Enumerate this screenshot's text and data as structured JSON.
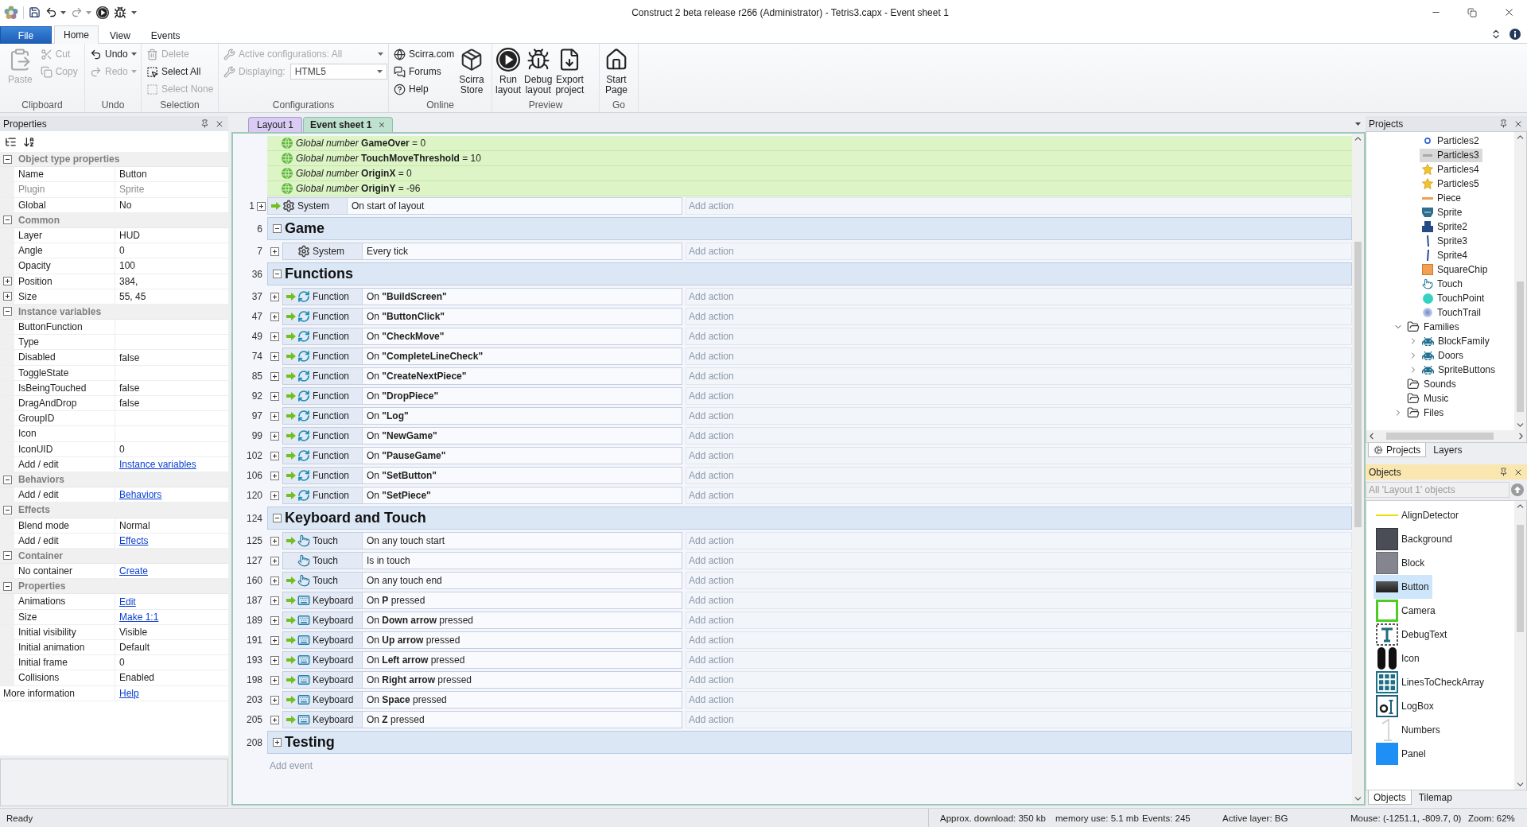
{
  "window": {
    "title": "Construct 2 beta release r266 (Administrator) - Tetris3.capx - Event sheet 1"
  },
  "ribbon": {
    "tabs": [
      {
        "label": "File",
        "kind": "file",
        "selected": false
      },
      {
        "label": "Home",
        "kind": "page",
        "selected": true
      },
      {
        "label": "View",
        "kind": "page",
        "selected": false
      },
      {
        "label": "Events",
        "kind": "page",
        "selected": false
      }
    ],
    "groups": [
      {
        "label": "Clipboard",
        "items": [
          {
            "kind": "large",
            "label": "Paste",
            "disabled": true
          },
          {
            "kind": "small",
            "label": "Cut",
            "disabled": true
          },
          {
            "kind": "small",
            "label": "Copy",
            "disabled": true
          }
        ]
      },
      {
        "label": "Undo",
        "items": [
          {
            "kind": "split",
            "label": "Undo",
            "disabled": false
          },
          {
            "kind": "split",
            "label": "Redo",
            "disabled": true
          }
        ]
      },
      {
        "label": "Selection",
        "items": [
          {
            "kind": "small",
            "label": "Delete",
            "disabled": true
          },
          {
            "kind": "small",
            "label": "Select All",
            "disabled": false
          },
          {
            "kind": "small",
            "label": "Select None",
            "disabled": true
          }
        ]
      },
      {
        "label": "Configurations",
        "items": [
          {
            "kind": "dropdown",
            "label": "Active configurations: All",
            "disabled": true
          },
          {
            "kind": "field",
            "label": "Displaying:",
            "value": "HTML5",
            "disabled": true
          }
        ]
      },
      {
        "label": "Online",
        "items": [
          {
            "kind": "small",
            "label": "Scirra.com",
            "disabled": false
          },
          {
            "kind": "small",
            "label": "Forums",
            "disabled": false
          },
          {
            "kind": "small",
            "label": "Help",
            "disabled": false
          },
          {
            "kind": "large",
            "label": "Scirra Store",
            "disabled": false
          }
        ]
      },
      {
        "label": "Preview",
        "items": [
          {
            "kind": "large",
            "label": "Run layout",
            "disabled": false
          },
          {
            "kind": "large",
            "label": "Debug layout",
            "disabled": false
          },
          {
            "kind": "large",
            "label": "Export project",
            "disabled": false
          }
        ]
      },
      {
        "label": "Go",
        "items": [
          {
            "kind": "large",
            "label": "Start Page",
            "disabled": false
          }
        ]
      }
    ]
  },
  "properties": {
    "title": "Properties",
    "active": false,
    "sections": [
      {
        "title": "Object type properties",
        "expanded": true,
        "rows": [
          {
            "name": "Name",
            "value": "Button",
            "kind": "text"
          },
          {
            "name": "Plugin",
            "value": "Sprite",
            "kind": "readonly"
          },
          {
            "name": "Global",
            "value": "No",
            "kind": "text"
          }
        ]
      },
      {
        "title": "Common",
        "expanded": true,
        "rows": [
          {
            "name": "Layer",
            "value": "HUD",
            "kind": "text"
          },
          {
            "name": "Angle",
            "value": "0",
            "kind": "text"
          },
          {
            "name": "Opacity",
            "value": "100",
            "kind": "text"
          },
          {
            "name": "Position",
            "value": "384,",
            "kind": "text",
            "expanded": false
          },
          {
            "name": "Size",
            "value": "55, 45",
            "kind": "text",
            "expanded": false
          }
        ]
      },
      {
        "title": "Instance variables",
        "expanded": true,
        "rows": [
          {
            "name": "ButtonFunction",
            "kind": "text"
          },
          {
            "name": "Type",
            "kind": "text"
          },
          {
            "name": "Disabled",
            "value": "false",
            "kind": "text"
          },
          {
            "name": "ToggleState",
            "kind": "text"
          },
          {
            "name": "IsBeingTouched",
            "value": "false",
            "kind": "text"
          },
          {
            "name": "DragAndDrop",
            "value": "false",
            "kind": "text"
          },
          {
            "name": "GroupID",
            "kind": "text"
          },
          {
            "name": "Icon",
            "kind": "text"
          },
          {
            "name": "IconUID",
            "value": "0",
            "kind": "text"
          },
          {
            "name": "Add / edit",
            "value": "Instance variables",
            "kind": "link"
          }
        ]
      },
      {
        "title": "Behaviors",
        "expanded": true,
        "rows": [
          {
            "name": "Add / edit",
            "value": "Behaviors",
            "kind": "link"
          }
        ]
      },
      {
        "title": "Effects",
        "expanded": true,
        "rows": [
          {
            "name": "Blend mode",
            "value": "Normal",
            "kind": "text"
          },
          {
            "name": "Add / edit",
            "value": "Effects",
            "kind": "link"
          }
        ]
      },
      {
        "title": "Container",
        "expanded": true,
        "rows": [
          {
            "name": "No container",
            "value": "Create",
            "kind": "link"
          }
        ]
      },
      {
        "title": "Properties",
        "expanded": true,
        "rows": [
          {
            "name": "Animations",
            "value": "Edit",
            "kind": "link"
          },
          {
            "name": "Size",
            "value": "Make 1:1",
            "kind": "link"
          },
          {
            "name": "Initial visibility",
            "value": "Visible",
            "kind": "text"
          },
          {
            "name": "Initial animation",
            "value": "Default",
            "kind": "text"
          },
          {
            "name": "Initial frame",
            "value": "0",
            "kind": "text"
          },
          {
            "name": "Collisions",
            "value": "Enabled",
            "kind": "text"
          }
        ]
      }
    ],
    "footer": {
      "name": "More information",
      "value": "Help",
      "kind": "link"
    }
  },
  "event_sheet": {
    "tabs": [
      {
        "label": "Layout 1",
        "kind": "layout",
        "selected": false
      },
      {
        "label": "Event sheet 1",
        "kind": "events",
        "selected": true
      }
    ],
    "globals": [
      "*Global number* **GameOver** = 0",
      "*Global number* **TouchMoveThreshold** = 10",
      "*Global number* **OriginX** = 0",
      "*Global number* **OriginY** = -96"
    ],
    "events": [
      {
        "kind": "system",
        "line": "1",
        "object": "System",
        "condition": "On start of layout",
        "action": "Add action",
        "trigger": true,
        "expanded": false
      },
      {
        "kind": "group",
        "line": "6",
        "title": "Game",
        "expanded": true,
        "children": [
          {
            "kind": "system",
            "line": "7",
            "object": "System",
            "condition": "Every tick",
            "action": "Add action",
            "trigger": false,
            "expanded": false
          }
        ]
      },
      {
        "kind": "group",
        "line": "36",
        "title": "Functions",
        "expanded": true,
        "children": [
          {
            "kind": "function",
            "line": "37",
            "object": "Function",
            "condition": "On **\"BuildScreen\"**",
            "action": "Add action",
            "trigger": true,
            "expanded": false
          },
          {
            "kind": "function",
            "line": "47",
            "object": "Function",
            "condition": "On **\"ButtonClick\"**",
            "action": "Add action",
            "trigger": true,
            "expanded": false
          },
          {
            "kind": "function",
            "line": "49",
            "object": "Function",
            "condition": "On **\"CheckMove\"**",
            "action": "Add action",
            "trigger": true,
            "expanded": false
          },
          {
            "kind": "function",
            "line": "74",
            "object": "Function",
            "condition": "On **\"CompleteLineCheck\"**",
            "action": "Add action",
            "trigger": true,
            "expanded": false
          },
          {
            "kind": "function",
            "line": "85",
            "object": "Function",
            "condition": "On **\"CreateNextPiece\"**",
            "action": "Add action",
            "trigger": true,
            "expanded": false
          },
          {
            "kind": "function",
            "line": "92",
            "object": "Function",
            "condition": "On **\"DropPiece\"**",
            "action": "Add action",
            "trigger": true,
            "expanded": false
          },
          {
            "kind": "function",
            "line": "97",
            "object": "Function",
            "condition": "On **\"Log\"**",
            "action": "Add action",
            "trigger": true,
            "expanded": false
          },
          {
            "kind": "function",
            "line": "99",
            "object": "Function",
            "condition": "On **\"NewGame\"**",
            "action": "Add action",
            "trigger": true,
            "expanded": false
          },
          {
            "kind": "function",
            "line": "102",
            "object": "Function",
            "condition": "On **\"PauseGame\"**",
            "action": "Add action",
            "trigger": true,
            "expanded": false
          },
          {
            "kind": "function",
            "line": "106",
            "object": "Function",
            "condition": "On **\"SetButton\"**",
            "action": "Add action",
            "trigger": true,
            "expanded": false
          },
          {
            "kind": "function",
            "line": "120",
            "object": "Function",
            "condition": "On **\"SetPiece\"**",
            "action": "Add action",
            "trigger": true,
            "expanded": false
          }
        ]
      },
      {
        "kind": "group",
        "line": "124",
        "title": "Keyboard and Touch",
        "expanded": true,
        "children": [
          {
            "kind": "touch",
            "line": "125",
            "object": "Touch",
            "condition": "On any touch start",
            "action": "Add action",
            "trigger": true,
            "expanded": false
          },
          {
            "kind": "touch",
            "line": "127",
            "object": "Touch",
            "condition": "Is in touch",
            "action": "Add action",
            "trigger": false,
            "expanded": false
          },
          {
            "kind": "touch",
            "line": "160",
            "object": "Touch",
            "condition": "On any touch end",
            "action": "Add action",
            "trigger": true,
            "expanded": false
          },
          {
            "kind": "keyboard",
            "line": "187",
            "object": "Keyboard",
            "condition": "On **P** pressed",
            "action": "Add action",
            "trigger": true,
            "expanded": false
          },
          {
            "kind": "keyboard",
            "line": "189",
            "object": "Keyboard",
            "condition": "On **Down arrow** pressed",
            "action": "Add action",
            "trigger": true,
            "expanded": false
          },
          {
            "kind": "keyboard",
            "line": "191",
            "object": "Keyboard",
            "condition": "On **Up arrow** pressed",
            "action": "Add action",
            "trigger": true,
            "expanded": false
          },
          {
            "kind": "keyboard",
            "line": "193",
            "object": "Keyboard",
            "condition": "On **Left arrow** pressed",
            "action": "Add action",
            "trigger": true,
            "expanded": false
          },
          {
            "kind": "keyboard",
            "line": "198",
            "object": "Keyboard",
            "condition": "On **Right arrow** pressed",
            "action": "Add action",
            "trigger": true,
            "expanded": false
          },
          {
            "kind": "keyboard",
            "line": "203",
            "object": "Keyboard",
            "condition": "On **Space** pressed",
            "action": "Add action",
            "trigger": true,
            "expanded": false
          },
          {
            "kind": "keyboard",
            "line": "205",
            "object": "Keyboard",
            "condition": "On **Z** pressed",
            "action": "Add action",
            "trigger": true,
            "expanded": false
          }
        ]
      },
      {
        "kind": "group",
        "line": "208",
        "title": "Testing",
        "expanded": false
      }
    ],
    "add_event": "Add event"
  },
  "projects": {
    "title": "Projects",
    "active": false,
    "tree": [
      {
        "children": [
          {
            "label": "Particles2",
            "kind": "object",
            "selected": false
          },
          {
            "label": "Particles3",
            "kind": "object",
            "selected": true
          },
          {
            "label": "Particles4",
            "kind": "object",
            "selected": false
          },
          {
            "label": "Particles5",
            "kind": "object",
            "selected": false
          },
          {
            "label": "Piece",
            "kind": "object",
            "selected": false
          },
          {
            "label": "Sprite",
            "kind": "object",
            "selected": false
          },
          {
            "label": "Sprite2",
            "kind": "object",
            "selected": false
          },
          {
            "label": "Sprite3",
            "kind": "object",
            "selected": false
          },
          {
            "label": "Sprite4",
            "kind": "object",
            "selected": false
          },
          {
            "label": "SquareChip",
            "kind": "object",
            "selected": false
          },
          {
            "label": "Touch",
            "kind": "object",
            "selected": false
          },
          {
            "label": "TouchPoint",
            "kind": "object",
            "selected": false
          },
          {
            "label": "TouchTrail",
            "kind": "object",
            "selected": false
          }
        ]
      },
      {
        "label": "Families",
        "kind": "folder",
        "expanded": true,
        "selected": false,
        "children": [
          {
            "label": "BlockFamily",
            "kind": "family",
            "expanded": false,
            "selected": false
          },
          {
            "label": "Doors",
            "kind": "family",
            "expanded": false,
            "selected": false
          },
          {
            "label": "SpriteButtons",
            "kind": "family",
            "expanded": false,
            "selected": false
          }
        ]
      },
      {
        "label": "Sounds",
        "kind": "folder",
        "selected": false
      },
      {
        "label": "Music",
        "kind": "folder",
        "selected": false
      },
      {
        "label": "Files",
        "kind": "folder",
        "expanded": false,
        "selected": false
      }
    ],
    "tabs": [
      {
        "label": "Projects",
        "selected": true
      },
      {
        "label": "Layers",
        "selected": false
      }
    ]
  },
  "objects": {
    "title": "Objects",
    "active": true,
    "filter": {
      "placeholder": "All 'Layout 1' objects"
    },
    "items": [
      {
        "label": "AlignDetector",
        "selected": false
      },
      {
        "label": "Background",
        "selected": false
      },
      {
        "label": "Block",
        "selected": false
      },
      {
        "label": "Button",
        "selected": true
      },
      {
        "label": "Camera",
        "selected": false
      },
      {
        "label": "DebugText",
        "selected": false
      },
      {
        "label": "Icon",
        "selected": false
      },
      {
        "label": "LinesToCheckArray",
        "selected": false
      },
      {
        "label": "LogBox",
        "selected": false
      },
      {
        "label": "Numbers",
        "selected": false
      },
      {
        "label": "Panel",
        "selected": false
      }
    ],
    "tabs": [
      {
        "label": "Objects",
        "selected": true
      },
      {
        "label": "Tilemap",
        "selected": false
      }
    ]
  },
  "status_bar": {
    "message": "Ready",
    "items": [
      "Approx. download: 350 kb",
      "memory use: 5.1 mb",
      "Events: 245",
      "Active layer: BG",
      "Mouse: (-1251.1, -809.7, 0)",
      "Zoom: 62%"
    ]
  }
}
